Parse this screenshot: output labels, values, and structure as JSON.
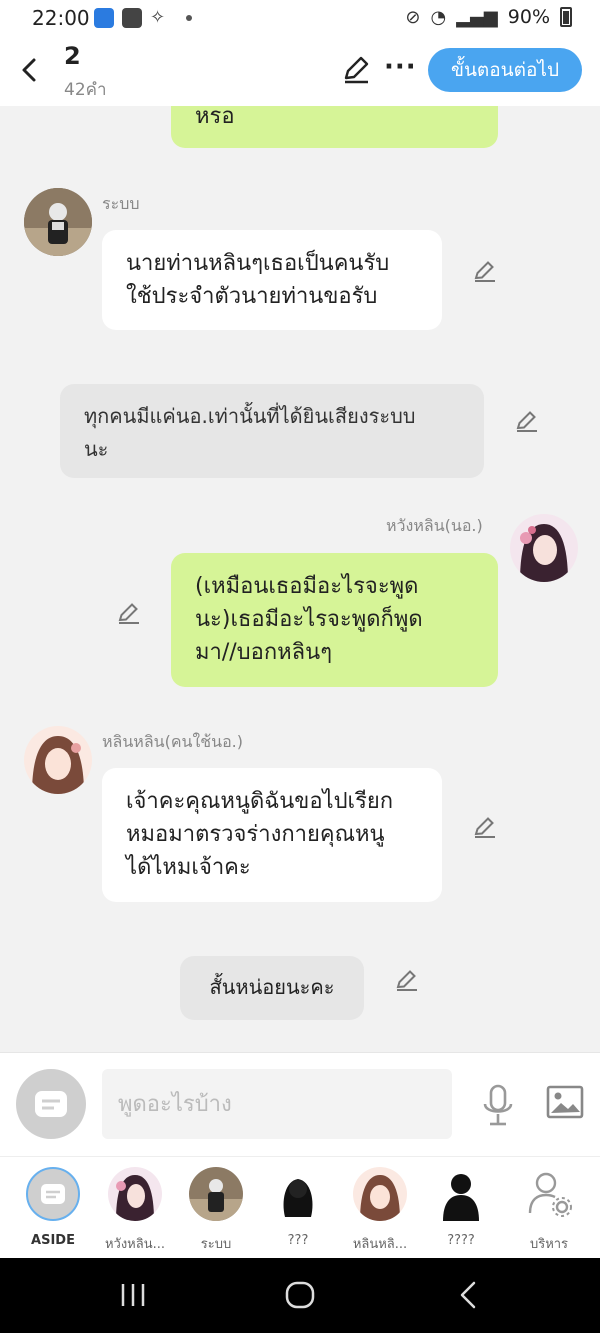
{
  "status_bar": {
    "time": "22:00",
    "battery": "90%"
  },
  "header": {
    "title": "2",
    "subtitle": "42คำ",
    "next_label": "ขั้นตอนต่อไป",
    "more": "···"
  },
  "messages": [
    {
      "type": "outgoing",
      "text": "หรอ"
    },
    {
      "type": "incoming",
      "sender": "ระบบ",
      "lines": [
        "นายท่านหลินๆเธอเป็นคนรับ",
        "ใช้ประจำตัวนายท่านขอรับ"
      ]
    },
    {
      "type": "narration",
      "lines": [
        "ทุกคนมีแค่นอ.เท่านั้นที่ได้ยินเสียงระบบ",
        "นะ"
      ]
    },
    {
      "type": "outgoing",
      "sender": "หวังหลิน(นอ.)",
      "lines": [
        "(เหมือนเธอมีอะไรจะพูด",
        "นะ)เธอมีอะไรจะพูดก็พูด",
        "มา//บอกหลินๆ"
      ]
    },
    {
      "type": "incoming",
      "sender": "หลินหลิน(คนใช้นอ.)",
      "lines": [
        "เจ้าคะคุณหนูดิฉันขอไปเรียก",
        "หมอมาตรวจร่างกายคุณหนู",
        "ได้ไหมเจ้าคะ"
      ]
    },
    {
      "type": "center",
      "text": "สั้นหน่อยนะคะ"
    }
  ],
  "input": {
    "placeholder": "พูดอะไรบ้าง"
  },
  "characters": [
    {
      "name": "ASIDE"
    },
    {
      "name": "หวังหลิน..."
    },
    {
      "name": "ระบบ"
    },
    {
      "name": "???"
    },
    {
      "name": "หลินหลิ..."
    },
    {
      "name": "????"
    },
    {
      "name": "บริหาร"
    }
  ],
  "colors": {
    "accent": "#4aa5f0",
    "outgoing_bubble": "#d6f497",
    "incoming_bubble": "#ffffff"
  },
  "icons": [
    "back-icon",
    "pencil-icon",
    "more-icon",
    "mic-icon",
    "image-icon",
    "aside-icon",
    "manage-icon"
  ]
}
